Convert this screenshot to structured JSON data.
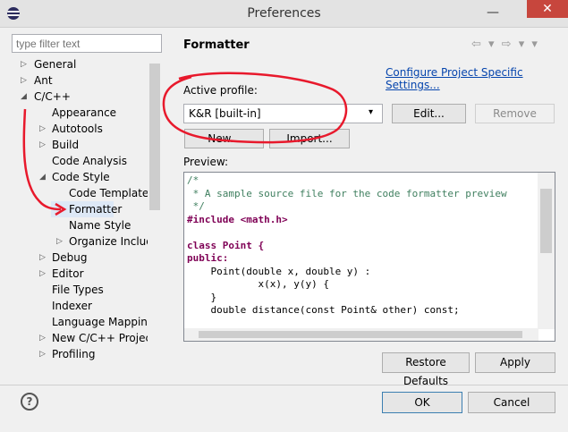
{
  "window": {
    "title": "Preferences",
    "minimize_glyph": "—",
    "close_glyph": "✕"
  },
  "filter": {
    "placeholder": "type filter text"
  },
  "tree": {
    "items": [
      {
        "label": "General",
        "expander": "▷"
      },
      {
        "label": "Ant",
        "expander": "▷"
      },
      {
        "label": "C/C++",
        "expander": "◢"
      },
      {
        "label": "Appearance",
        "expander": ""
      },
      {
        "label": "Autotools",
        "expander": "▷"
      },
      {
        "label": "Build",
        "expander": "▷"
      },
      {
        "label": "Code Analysis",
        "expander": ""
      },
      {
        "label": "Code Style",
        "expander": "◢"
      },
      {
        "label": "Code Templates",
        "expander": ""
      },
      {
        "label": "Formatter",
        "expander": ""
      },
      {
        "label": "Name Style",
        "expander": ""
      },
      {
        "label": "Organize Includes",
        "expander": "▷"
      },
      {
        "label": "Debug",
        "expander": "▷"
      },
      {
        "label": "Editor",
        "expander": "▷"
      },
      {
        "label": "File Types",
        "expander": ""
      },
      {
        "label": "Indexer",
        "expander": ""
      },
      {
        "label": "Language Mappings",
        "expander": ""
      },
      {
        "label": "New C/C++ Project",
        "expander": "▷"
      },
      {
        "label": "Profiling",
        "expander": "▷"
      }
    ]
  },
  "page": {
    "title": "Formatter",
    "nav_arrows": "⇦ ▾ ⇨ ▾ ▾",
    "config_link": "Configure Project Specific Settings...",
    "active_profile_label": "Active profile:",
    "profile_value": "K&R [built-in]",
    "profile_arrow": "▾",
    "edit_button": "Edit...",
    "remove_button": "Remove",
    "new_button": "New...",
    "import_button": "Import...",
    "preview_label": "Preview:",
    "preview_lines": [
      "/*",
      " * A sample source file for the code formatter preview",
      " */",
      "#include <math.h>",
      "",
      "class Point {",
      "public:",
      "    Point(double x, double y) :",
      "            x(x), y(y) {",
      "    }",
      "    double distance(const Point& other) const;"
    ],
    "restore_defaults_button": "Restore Defaults",
    "apply_button": "Apply"
  },
  "footer": {
    "help_glyph": "?",
    "ok_button": "OK",
    "cancel_button": "Cancel"
  },
  "colors": {
    "annotation_red": "#e8192c",
    "selection": "#dde8f6",
    "link": "#0645ad",
    "comment": "#3f7f5f",
    "keyword": "#7f0055",
    "include_path": "#2a00ff"
  }
}
